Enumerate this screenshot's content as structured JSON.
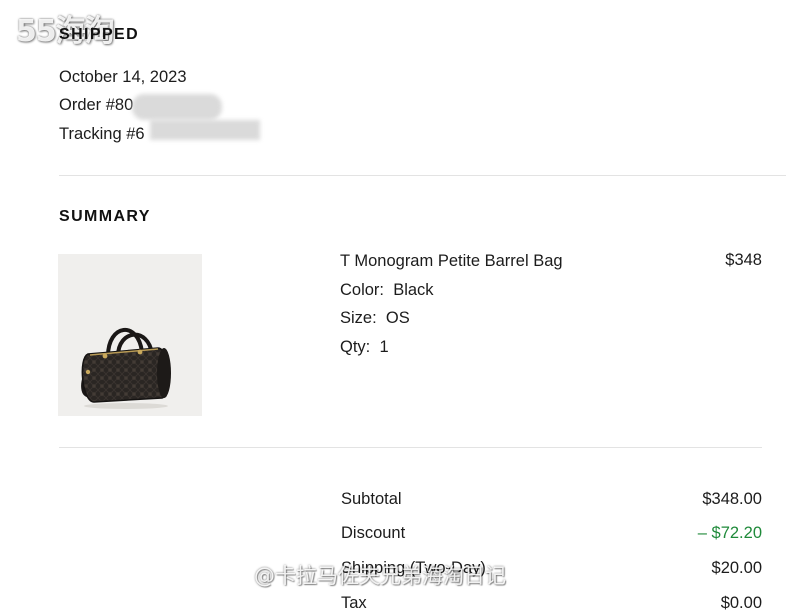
{
  "watermark": {
    "logo_text": "55海淘",
    "bottom_text": "@卡拉马佐夫兄弟海淘日记"
  },
  "shipment": {
    "title": "SHIPPED",
    "date": "October 14, 2023",
    "order_prefix": "Order #80",
    "tracking_prefix": "Tracking #6"
  },
  "summary": {
    "title": "SUMMARY",
    "item": {
      "name": "T Monogram Petite Barrel Bag",
      "color_label": "Color:",
      "color_value": "Black",
      "size_label": "Size:",
      "size_value": "OS",
      "qty_label": "Qty:",
      "qty_value": "1",
      "price": "$348"
    }
  },
  "totals": [
    {
      "label": "Subtotal",
      "value": "$348.00"
    },
    {
      "label": "Discount",
      "value": "– $72.20"
    },
    {
      "label": "Shipping (Two-Day)",
      "value": "$20.00"
    },
    {
      "label": "Tax",
      "value": "$0.00"
    }
  ],
  "colors": {
    "discount": "#1f8a3a",
    "text": "#1c1c1c",
    "divider": "#e3e3e3"
  }
}
